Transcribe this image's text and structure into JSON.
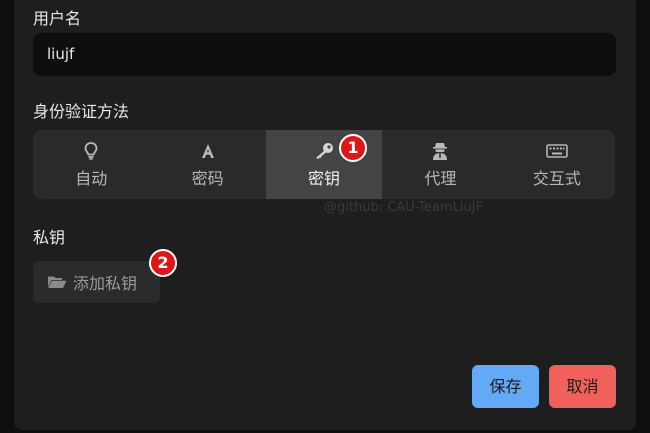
{
  "username": {
    "label": "用户名",
    "value": "liujf"
  },
  "auth": {
    "label": "身份验证方法",
    "options": [
      {
        "label": "自动",
        "icon": "lightbulb-icon"
      },
      {
        "label": "密码",
        "icon": "letter-a-icon"
      },
      {
        "label": "密钥",
        "icon": "key-icon",
        "selected": true
      },
      {
        "label": "代理",
        "icon": "user-secret-icon"
      },
      {
        "label": "交互式",
        "icon": "keyboard-icon"
      }
    ]
  },
  "watermark": "@github: CAU-TeamLiuJF",
  "private_key": {
    "label": "私钥",
    "add_button": "添加私钥",
    "icon": "folder-open-icon"
  },
  "annotations": {
    "badge_1": "1",
    "badge_2": "2"
  },
  "buttons": {
    "save": "保存",
    "cancel": "取消"
  },
  "colors": {
    "save": "#64a9f5",
    "cancel": "#f2605c",
    "badge": "#e01515"
  }
}
